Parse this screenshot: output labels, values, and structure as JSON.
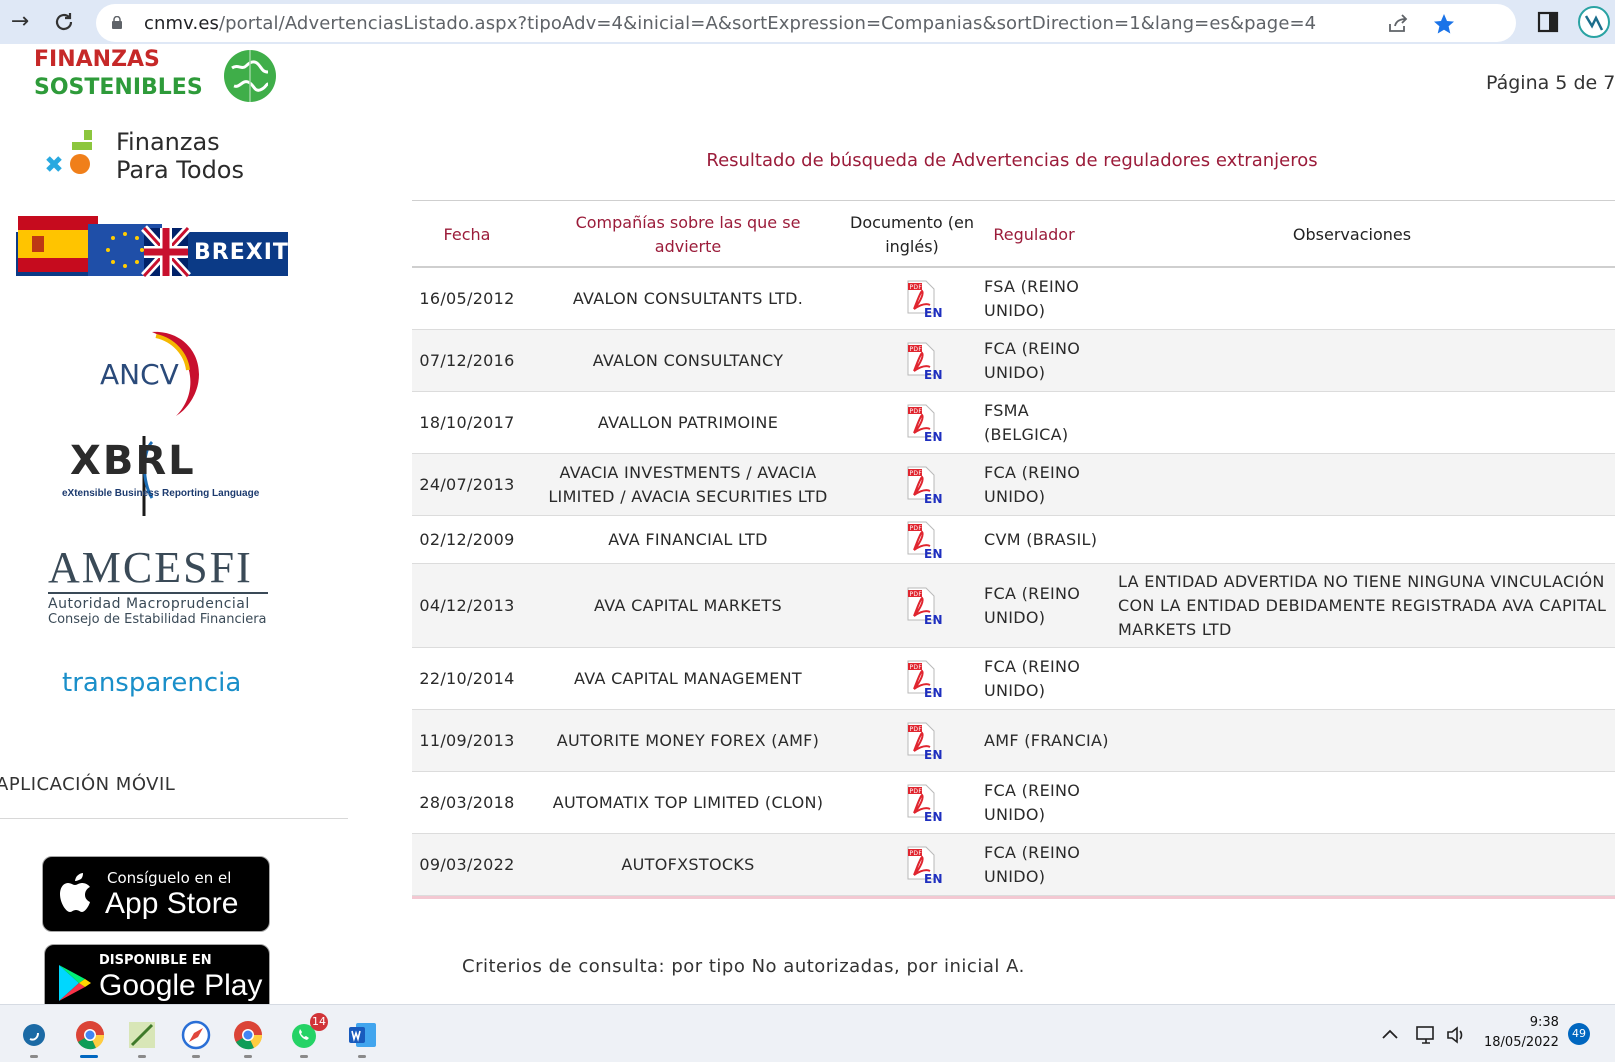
{
  "browser": {
    "url_host": "cnmv.es",
    "url_path": "/portal/AdvertenciasListado.aspx?tipoAdv=4&inicial=A&sortExpression=Companias&sortDirection=1&lang=es&page=4"
  },
  "sidebar": {
    "fs_line1": "FINANZAS",
    "fs_line2": "SOSTENIBLES",
    "fpt_line1": "Finanzas",
    "fpt_line2": "Para Todos",
    "brexit_label": "BREXIT",
    "ancv_label": "ANCV",
    "xbrl_label": "XBRL",
    "xbrl_sub": "eXtensible Business Reporting Language",
    "amcesfi_title": "AMCESFI",
    "amcesfi_sub1": "Autoridad Macroprudencial",
    "amcesfi_sub2": "Consejo de Estabilidad Financiera",
    "transparencia": "transparencia",
    "app_heading": "APLICACIÓN MÓVIL",
    "appstore_small": "Consíguelo en el",
    "appstore_big": "App Store",
    "gplay_small": "DISPONIBLE EN",
    "gplay_big": "Google Play"
  },
  "main": {
    "page_indicator": "Página 5 de 7",
    "results_title": "Resultado de búsqueda de Advertencias de reguladores extranjeros",
    "columns": {
      "fecha": "Fecha",
      "companias": "Compañías sobre las que se advierte",
      "documento": "Documento (en inglés)",
      "regulador": "Regulador",
      "observaciones": "Observaciones"
    },
    "rows": [
      {
        "fecha": "16/05/2012",
        "compania": "AVALON CONSULTANTS LTD.",
        "regulador": "FSA (REINO UNIDO)",
        "observaciones": ""
      },
      {
        "fecha": "07/12/2016",
        "compania": "AVALON CONSULTANCY",
        "regulador": "FCA (REINO UNIDO)",
        "observaciones": ""
      },
      {
        "fecha": "18/10/2017",
        "compania": "AVALLON PATRIMOINE",
        "regulador": "FSMA (BELGICA)",
        "observaciones": ""
      },
      {
        "fecha": "24/07/2013",
        "compania": "AVACIA INVESTMENTS / AVACIA LIMITED / AVACIA SECURITIES LTD",
        "regulador": "FCA (REINO UNIDO)",
        "observaciones": ""
      },
      {
        "fecha": "02/12/2009",
        "compania": "AVA FINANCIAL LTD",
        "regulador": "CVM (BRASIL)",
        "observaciones": ""
      },
      {
        "fecha": "04/12/2013",
        "compania": "AVA CAPITAL MARKETS",
        "regulador": "FCA (REINO UNIDO)",
        "observaciones": "LA ENTIDAD ADVERTIDA NO TIENE NINGUNA VINCULACIÓN CON LA ENTIDAD DEBIDAMENTE REGISTRADA AVA CAPITAL MARKETS LTD"
      },
      {
        "fecha": "22/10/2014",
        "compania": "AVA CAPITAL MANAGEMENT",
        "regulador": "FCA (REINO UNIDO)",
        "observaciones": ""
      },
      {
        "fecha": "11/09/2013",
        "compania": "AUTORITE MONEY FOREX (AMF)",
        "regulador": "AMF (FRANCIA)",
        "observaciones": ""
      },
      {
        "fecha": "28/03/2018",
        "compania": "AUTOMATIX TOP LIMITED (CLON)",
        "regulador": "FCA (REINO UNIDO)",
        "observaciones": ""
      },
      {
        "fecha": "09/03/2022",
        "compania": "AUTOFXSTOCKS",
        "regulador": "FCA (REINO UNIDO)",
        "observaciones": ""
      }
    ],
    "pdf_icon_label": "EN",
    "pdf_tag": "PDF",
    "criteria": "Criterios de consulta: por tipo No autorizadas, por inicial A."
  },
  "taskbar": {
    "whatsapp_badge": "14",
    "time": "9:38",
    "date": "18/05/2022",
    "notifications": "49"
  },
  "colors": {
    "accent": "#9b1c3a",
    "browser_chrome": "#dfe8f6",
    "taskbar": "#eef1f6"
  }
}
